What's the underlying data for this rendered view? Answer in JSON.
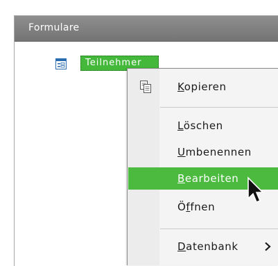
{
  "panel": {
    "title": "Formulare"
  },
  "tree": {
    "item_label": "Teilnehmer",
    "item_icon": "form-icon"
  },
  "context_menu": {
    "items": [
      {
        "label": "Kopieren",
        "mnemonic": "K",
        "rest": "opieren",
        "icon": "copy-icon"
      },
      {
        "label": "Löschen",
        "mnemonic": "L",
        "rest": "öschen"
      },
      {
        "label": "Umbenennen",
        "mnemonic": "U",
        "rest": "mbenennen"
      },
      {
        "label": "Bearbeiten",
        "mnemonic": "B",
        "rest": "earbeiten",
        "highlighted": true
      },
      {
        "label": "Öffnen",
        "pre": "Ö",
        "mnemonic": "f",
        "rest": "fnen"
      },
      {
        "label": "Datenbank",
        "mnemonic": "D",
        "rest": "atenbank",
        "submenu_icon": "chevron-right-icon"
      }
    ]
  },
  "colors": {
    "highlight": "#4cba3f",
    "header": "#7f7f7f",
    "menu_bg": "#f4f4f4"
  }
}
